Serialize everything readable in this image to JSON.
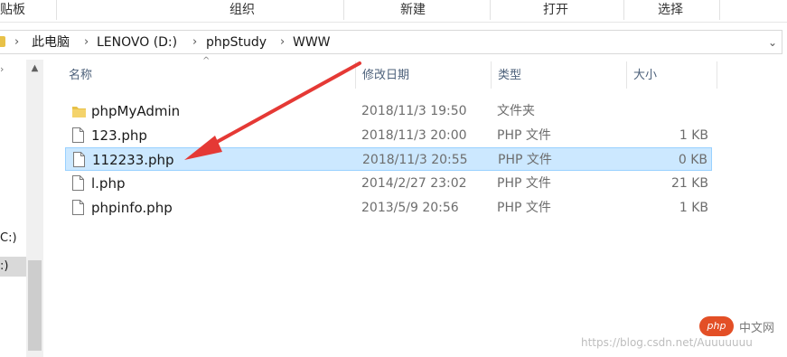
{
  "ribbon": {
    "tabs": [
      "贴板",
      "组织",
      "新建",
      "打开",
      "选择"
    ]
  },
  "address": {
    "crumbs": [
      "此电脑",
      "LENOVO (D:)",
      "phpStudy",
      "WWW"
    ],
    "dropdown_icon": "chevron-down-icon"
  },
  "nav": {
    "item_c": "C:)",
    "item_d": ":)"
  },
  "columns": {
    "name": "名称",
    "date": "修改日期",
    "type": "类型",
    "size": "大小"
  },
  "files": [
    {
      "name": "phpMyAdmin",
      "date": "2018/11/3 19:50",
      "type": "文件夹",
      "size": "",
      "icon": "folder-icon"
    },
    {
      "name": "123.php",
      "date": "2018/11/3 20:00",
      "type": "PHP 文件",
      "size": "1 KB",
      "icon": "file-icon"
    },
    {
      "name": "112233.php",
      "date": "2018/11/3 20:55",
      "type": "PHP 文件",
      "size": "0 KB",
      "icon": "file-icon",
      "selected": true
    },
    {
      "name": "l.php",
      "date": "2014/2/27 23:02",
      "type": "PHP 文件",
      "size": "21 KB",
      "icon": "file-icon"
    },
    {
      "name": "phpinfo.php",
      "date": "2013/5/9 20:56",
      "type": "PHP 文件",
      "size": "1 KB",
      "icon": "file-icon"
    }
  ],
  "annotation": {
    "color": "#e53935"
  },
  "watermark": {
    "logo": "php",
    "site": "中文网",
    "url": "https://blog.csdn.net/Auuuuuuu"
  }
}
